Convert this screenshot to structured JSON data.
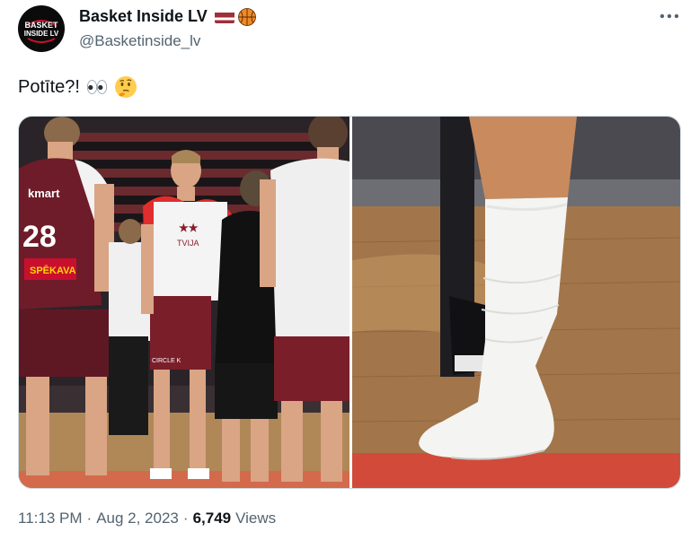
{
  "author": {
    "display_name": "Basket Inside LV",
    "handle": "@Basketinside_lv",
    "avatar_text": "BASKET INSIDE LV",
    "flag_color": "#9e3039",
    "badges": [
      "latvia-flag-icon",
      "basketball-icon"
    ]
  },
  "menu": {
    "more_icon": "more-horizontal-icon"
  },
  "tweet": {
    "text": "Potīte?!",
    "emojis": [
      "eyes-emoji",
      "thinking-face-emoji"
    ]
  },
  "media": {
    "photos": [
      {
        "name": "team-huddle-photo",
        "jersey_number": "28",
        "jersey_brand": "kmart",
        "sponsor": "SPĒKAVA",
        "shirt_text": "TVIJA",
        "shorts_logo": "CIRCLE K"
      },
      {
        "name": "sock-closeup-photo"
      }
    ]
  },
  "meta": {
    "time": "11:13 PM",
    "date": "Aug 2, 2023",
    "views_count": "6,749",
    "views_label": "Views",
    "separator": "·"
  },
  "colors": {
    "text_primary": "#0f1419",
    "text_secondary": "#536471",
    "border": "#cfd9de",
    "latvia_red": "#9e3039"
  }
}
